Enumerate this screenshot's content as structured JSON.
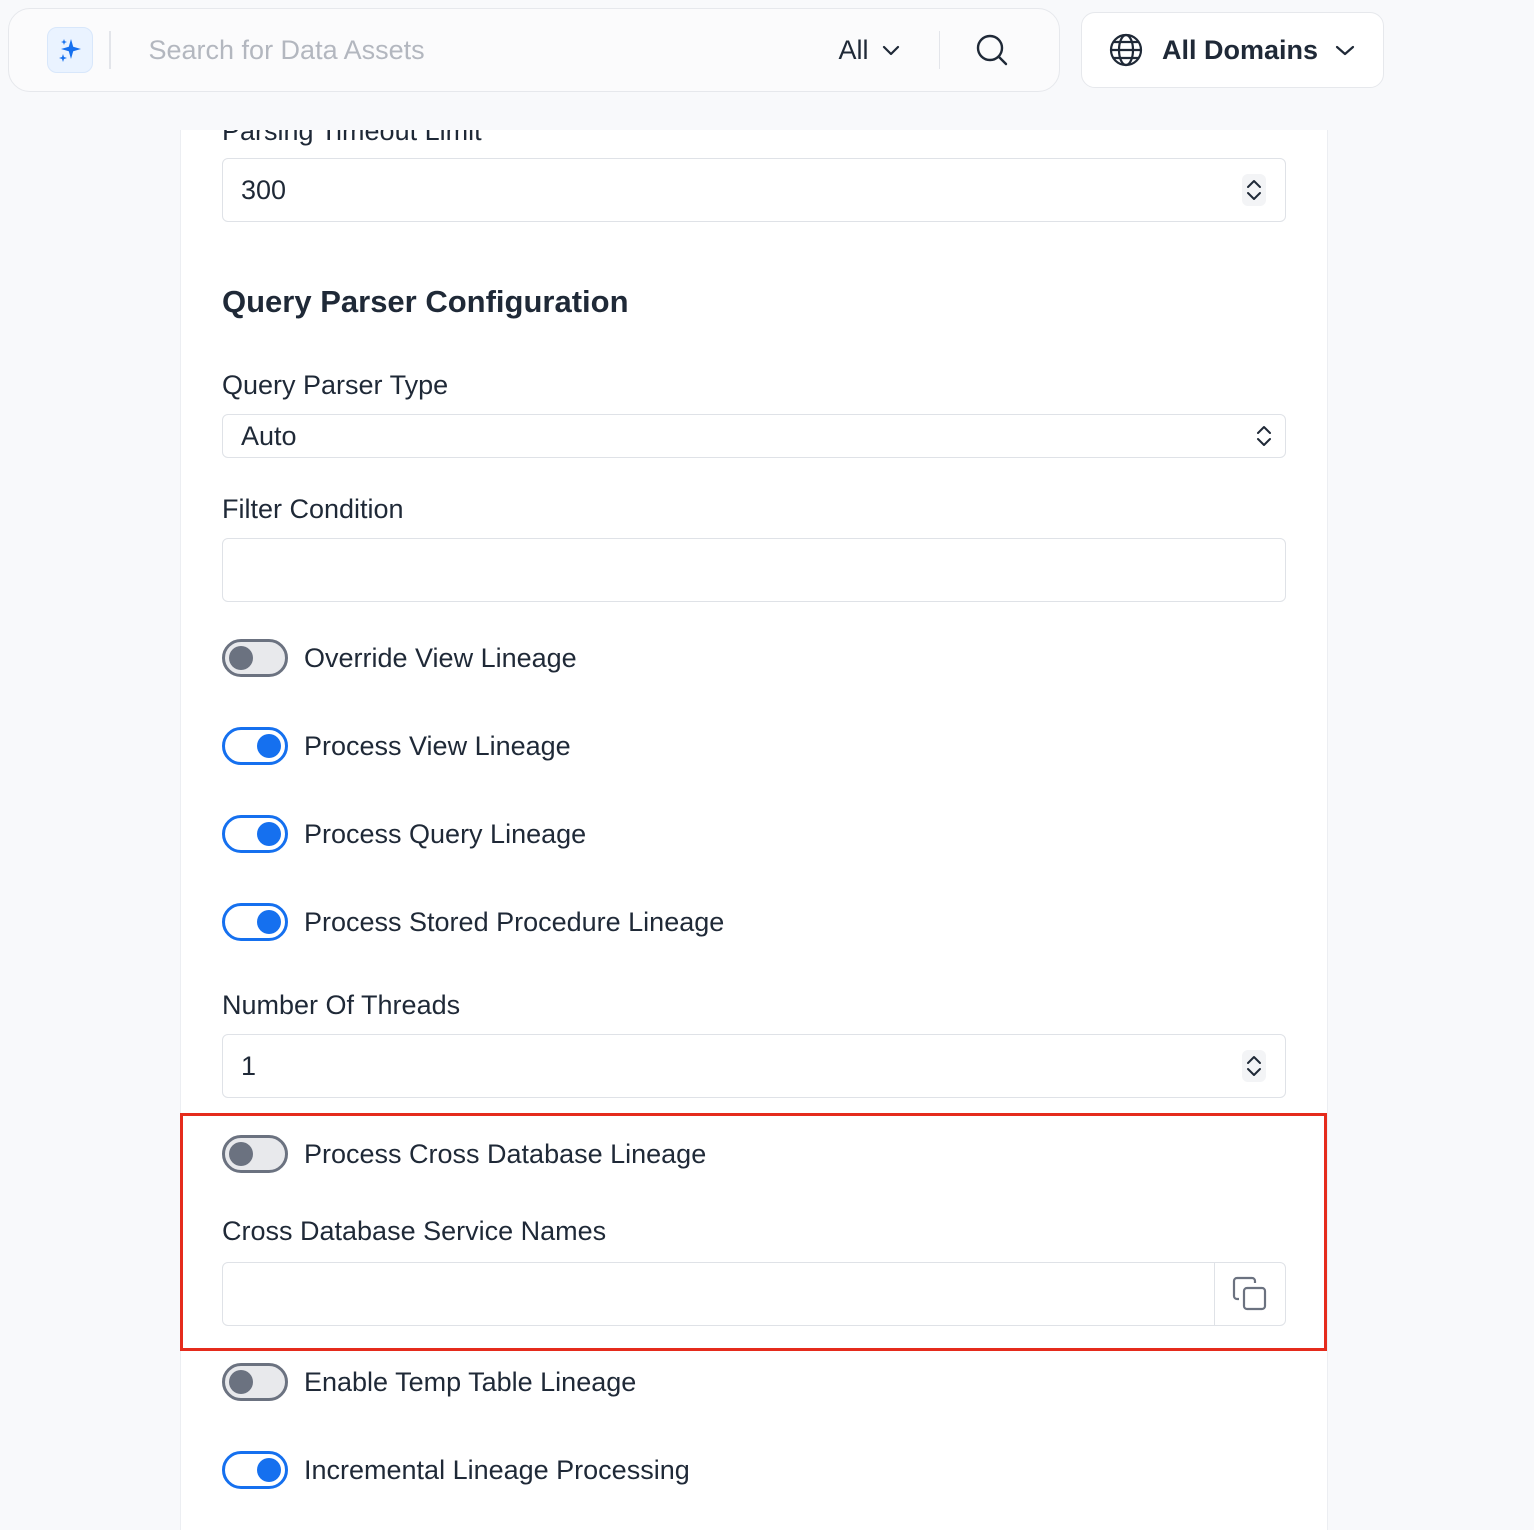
{
  "header": {
    "search": {
      "placeholder": "Search for Data Assets",
      "value": ""
    },
    "filter": {
      "selected": "All"
    },
    "domains": {
      "label": "All Domains"
    },
    "icons": {
      "ai": "sparkle-icon",
      "search": "search-icon",
      "globe": "globe-icon",
      "chevron": "chevron-down-icon"
    },
    "accent_color": "#1570ef"
  },
  "form": {
    "parsing_timeout": {
      "label": "Parsing Timeout Limit",
      "value": "300"
    },
    "query_parser_section": {
      "title": "Query Parser Configuration"
    },
    "query_parser_type": {
      "label": "Query Parser Type",
      "value": "Auto"
    },
    "filter_condition": {
      "label": "Filter Condition",
      "value": ""
    },
    "toggles": [
      {
        "label": "Override View Lineage",
        "on": false
      },
      {
        "label": "Process View Lineage",
        "on": true
      },
      {
        "label": "Process Query Lineage",
        "on": true
      },
      {
        "label": "Process Stored Procedure Lineage",
        "on": true
      }
    ],
    "threads": {
      "label": "Number Of Threads",
      "value": "1"
    },
    "cross_db_toggle": {
      "label": "Process Cross Database Lineage",
      "on": false
    },
    "cross_db_service_names": {
      "label": "Cross Database Service Names",
      "value": ""
    },
    "bottom_toggles": [
      {
        "label": "Enable Temp Table Lineage",
        "on": false
      },
      {
        "label": "Incremental Lineage Processing",
        "on": true
      }
    ],
    "highlight_color": "#e52b1c"
  }
}
